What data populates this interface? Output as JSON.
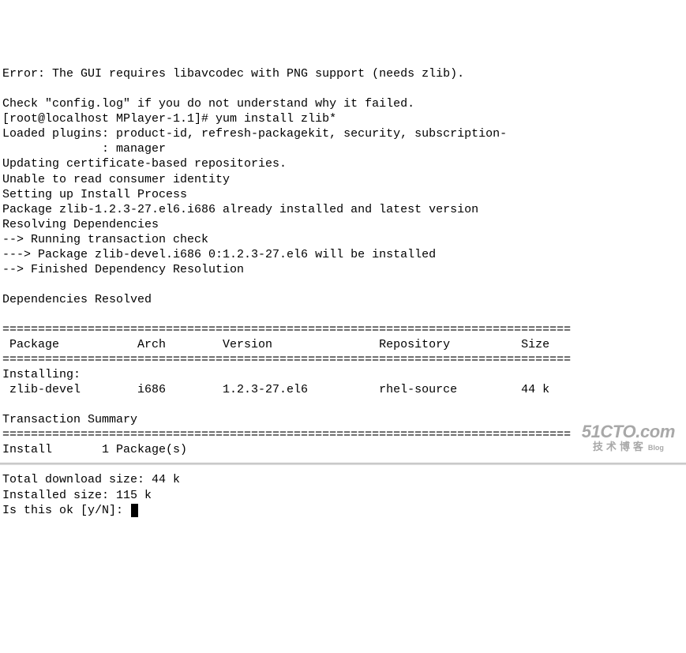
{
  "terminal": {
    "lines": [
      "Error: The GUI requires libavcodec with PNG support (needs zlib).",
      "",
      "Check \"config.log\" if you do not understand why it failed.",
      "[root@localhost MPlayer-1.1]# yum install zlib*",
      "Loaded plugins: product-id, refresh-packagekit, security, subscription-",
      "              : manager",
      "Updating certificate-based repositories.",
      "Unable to read consumer identity",
      "Setting up Install Process",
      "Package zlib-1.2.3-27.el6.i686 already installed and latest version",
      "Resolving Dependencies",
      "--> Running transaction check",
      "---> Package zlib-devel.i686 0:1.2.3-27.el6 will be installed",
      "--> Finished Dependency Resolution",
      "",
      "Dependencies Resolved",
      "",
      "================================================================================",
      " Package           Arch        Version               Repository          Size",
      "================================================================================",
      "Installing:",
      " zlib-devel        i686        1.2.3-27.el6          rhel-source         44 k",
      "",
      "Transaction Summary",
      "================================================================================",
      "Install       1 Package(s)",
      "",
      "Total download size: 44 k",
      "Installed size: 115 k"
    ],
    "prompt_line": "Is this ok [y/N]: "
  },
  "watermark": {
    "main": "51CTO.com",
    "sub": "技术博客",
    "small": "Blog"
  }
}
